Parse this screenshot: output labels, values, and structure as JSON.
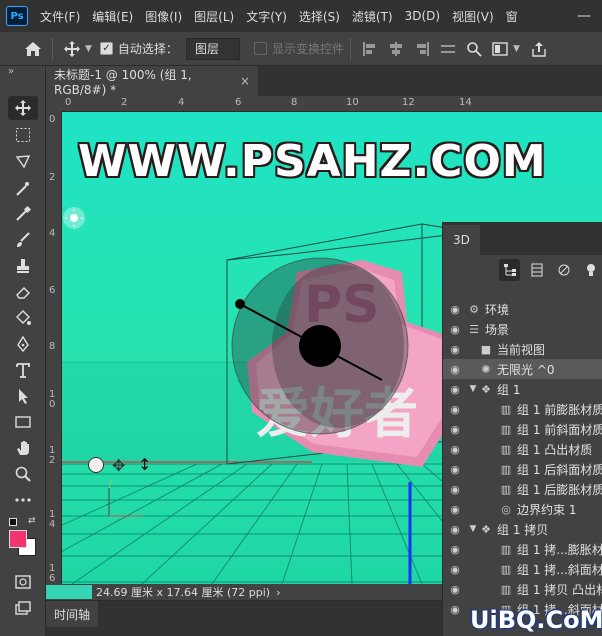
{
  "app": {
    "logo": "Ps"
  },
  "menu": {
    "items": [
      "文件(F)",
      "编辑(E)",
      "图像(I)",
      "图层(L)",
      "文字(Y)",
      "选择(S)",
      "滤镜(T)",
      "3D(D)",
      "视图(V)",
      "窗"
    ]
  },
  "window_controls": {
    "minimize": "—",
    "maximize": "☐",
    "close": "✕"
  },
  "options_bar": {
    "auto_select_label": "自动选择：",
    "auto_select_checked": true,
    "layer_select_value": "图层",
    "show_transform_label": "显示变换控件",
    "show_transform_checked": false
  },
  "toolbox": {
    "collapse": "»",
    "tools": [
      "move-tool",
      "marquee-tool",
      "lasso-tool",
      "quick-select-tool",
      "eyedropper-tool",
      "brush-tool",
      "stamp-tool",
      "eraser-tool",
      "fill-tool",
      "pen-tool",
      "type-tool",
      "path-select-tool",
      "direct-select-tool",
      "rectangle-tool",
      "hand-tool",
      "zoom-tool",
      "more-tools"
    ],
    "foreground_color": "#f2356f",
    "background_color": "#ffffff"
  },
  "document": {
    "tab_title": "未标题-1 @ 100% (组 1, RGB/8#) *",
    "close": "×"
  },
  "rulers": {
    "h_labels": [
      "0",
      "2",
      "4",
      "6",
      "8",
      "10",
      "12",
      "14"
    ],
    "v_labels": [
      "0",
      "2",
      "4",
      "6",
      "8",
      "1\n0",
      "1\n2",
      "1\n4",
      "1\n6"
    ]
  },
  "canvas": {
    "watermark": "WWW.PSAHZ.COM",
    "art_text_top": "PS",
    "art_text_bottom": "爱好者",
    "gradient_top": "#1fe3c5",
    "gradient_bottom": "#1ed7a4"
  },
  "status_bar": {
    "info": "24.69 厘米 x 17.64 厘米 (72 ppi)",
    "arrow": "›"
  },
  "timeline": {
    "tab": "时间轴"
  },
  "panel_3d": {
    "tab": "3D",
    "tree": [
      {
        "label": "环境",
        "icon": "environment-icon",
        "level": 0
      },
      {
        "label": "场景",
        "icon": "scene-icon",
        "level": 0
      },
      {
        "label": "当前视图",
        "icon": "camera-icon",
        "level": 1
      },
      {
        "label": "无限光 ^0",
        "icon": "light-icon",
        "level": 1,
        "selected": true
      },
      {
        "label": "组 1",
        "icon": "group-icon",
        "level": 1,
        "expanded": true
      },
      {
        "label": "组 1 前膨胀材质",
        "icon": "material-icon",
        "level": 2
      },
      {
        "label": "组 1 前斜面材质",
        "icon": "material-icon",
        "level": 2
      },
      {
        "label": "组 1 凸出材质",
        "icon": "material-icon",
        "level": 2
      },
      {
        "label": "组 1 后斜面材质",
        "icon": "material-icon",
        "level": 2
      },
      {
        "label": "组 1 后膨胀材质",
        "icon": "material-icon",
        "level": 2
      },
      {
        "label": "边界约束 1",
        "icon": "constraint-icon",
        "level": 2
      },
      {
        "label": "组 1 拷贝",
        "icon": "group-icon",
        "level": 1,
        "expanded": true
      },
      {
        "label": "组 1 拷...膨胀材",
        "icon": "material-icon",
        "level": 2
      },
      {
        "label": "组 1 拷...斜面材",
        "icon": "material-icon",
        "level": 2
      },
      {
        "label": "组 1 拷贝 凸出材",
        "icon": "material-icon",
        "level": 2
      },
      {
        "label": "组 1 拷...斜面材",
        "icon": "material-icon",
        "level": 2
      }
    ]
  },
  "site_watermark": "UiBQ.CoM"
}
